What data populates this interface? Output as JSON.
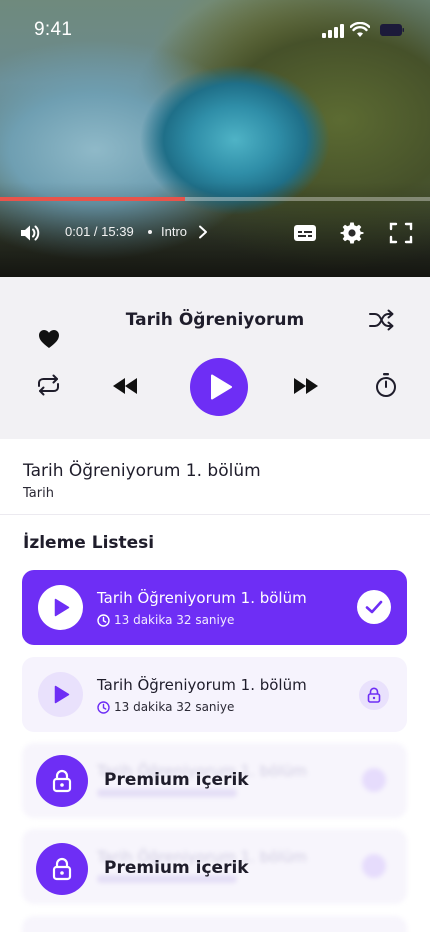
{
  "status_bar": {
    "time": "9:41"
  },
  "video": {
    "progress_fraction": 0.43,
    "current_time": "0:01 / 15:39",
    "chapter": "Intro"
  },
  "player": {
    "title": "Tarih Öğreniyorum",
    "accent_color": "#6e2ef5"
  },
  "now_playing": {
    "title": "Tarih Öğreniyorum 1. bölüm",
    "category": "Tarih"
  },
  "watchlist": {
    "heading": "İzleme Listesi",
    "items": [
      {
        "title": "Tarih Öğreniyorum 1. bölüm",
        "duration": "13 dakika 32 saniye",
        "state": "completed",
        "icon": "check-icon"
      },
      {
        "title": "Tarih Öğreniyorum 1. bölüm",
        "duration": "13 dakika 32 saniye",
        "state": "locked",
        "icon": "lock-icon"
      }
    ],
    "premium": [
      {
        "label": "Premium içerik",
        "hidden_title": "Tarih Öğreniyorum 1. bölüm"
      },
      {
        "label": "Premium içerik",
        "hidden_title": "Tarih Öğreniyorum 1. bölüm"
      }
    ]
  }
}
